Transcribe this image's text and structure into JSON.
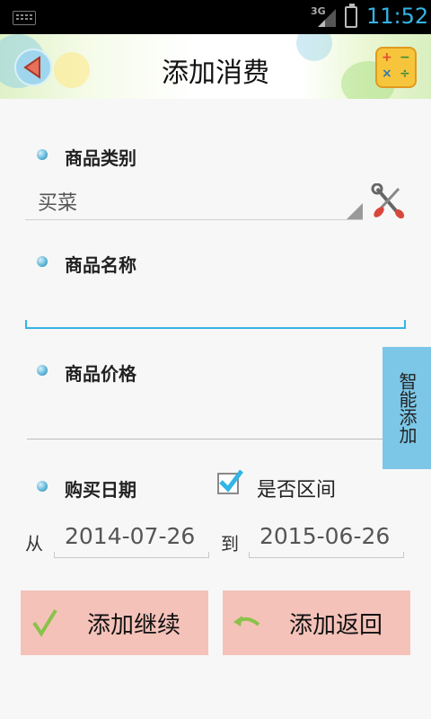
{
  "status_bar": {
    "network": "3G",
    "time": "11:52"
  },
  "header": {
    "title": "添加消费"
  },
  "form": {
    "category_label": "商品类别",
    "category_value": "买菜",
    "name_label": "商品名称",
    "name_value": "",
    "price_label": "商品价格",
    "price_value": "",
    "date_label": "购买日期",
    "range_checkbox_label": "是否区间",
    "range_checked": true,
    "from_label": "从",
    "from_date": "2014-07-26",
    "to_label": "到",
    "to_date": "2015-06-26"
  },
  "side_button": {
    "label": "智能添加"
  },
  "buttons": {
    "add_continue": "添加继续",
    "add_return": "添加返回"
  },
  "colors": {
    "accent": "#33b5e5",
    "button_bg": "#f4c2b9",
    "side_button_bg": "#7cc7e7"
  },
  "icons": [
    "keyboard-icon",
    "signal-icon",
    "battery-icon",
    "back-arrow-icon",
    "calculator-icon",
    "tools-icon",
    "checkmark-icon",
    "return-arrow-icon"
  ]
}
